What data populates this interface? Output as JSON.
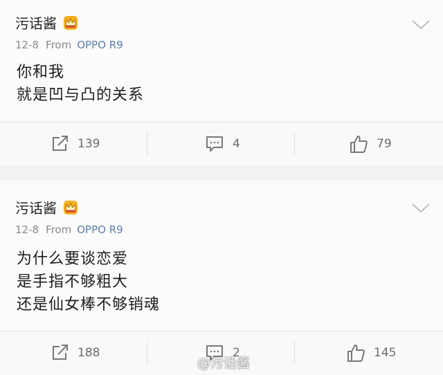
{
  "posts": [
    {
      "author": "污话酱",
      "date": "12-8",
      "from_label": "From",
      "source": "OPPO R9",
      "lines": [
        "你和我",
        "就是凹与凸的关系"
      ],
      "repost_count": "139",
      "comment_count": "4",
      "like_count": "79"
    },
    {
      "author": "污话酱",
      "date": "12-8",
      "from_label": "From",
      "source": "OPPO R9",
      "lines": [
        "为什么要谈恋爱",
        "是手指不够粗大",
        "还是仙女棒不够销魂"
      ],
      "repost_count": "188",
      "comment_count": "2",
      "like_count": "145"
    }
  ],
  "watermark": "@污话酱",
  "icons": {
    "crown": "crown-badge-icon",
    "expand": "chevron-down-icon",
    "repost": "repost-icon",
    "comment": "comment-icon",
    "like": "thumbs-up-icon"
  },
  "colors": {
    "source_link": "#5b7fa8",
    "crown": "#f0b020",
    "background": "#f2f2f2"
  }
}
